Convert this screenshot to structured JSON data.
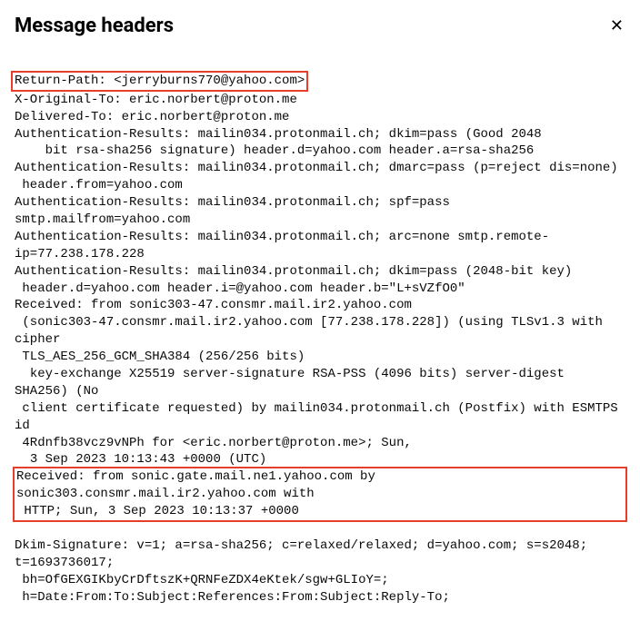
{
  "modal": {
    "title": "Message headers"
  },
  "headers": {
    "return_path": "Return-Path: <jerryburns770@yahoo.com>",
    "x_original_to": "X-Original-To: eric.norbert@proton.me",
    "delivered_to": "Delivered-To: eric.norbert@proton.me",
    "auth1_l1": "Authentication-Results: mailin034.protonmail.ch; dkim=pass (Good 2048",
    "auth1_l2": "    bit rsa-sha256 signature) header.d=yahoo.com header.a=rsa-sha256",
    "auth2_l1": "Authentication-Results: mailin034.protonmail.ch; dmarc=pass (p=reject dis=none)",
    "auth2_l2": " header.from=yahoo.com",
    "auth3_l1": "Authentication-Results: mailin034.protonmail.ch; spf=pass smtp.mailfrom=yahoo.com",
    "auth4_l1": "Authentication-Results: mailin034.protonmail.ch; arc=none smtp.remote-ip=77.238.178.228",
    "auth5_l1": "Authentication-Results: mailin034.protonmail.ch; dkim=pass (2048-bit key)",
    "auth5_l2": " header.d=yahoo.com header.i=@yahoo.com header.b=\"L+sVZfO0\"",
    "recv1_l1": "Received: from sonic303-47.consmr.mail.ir2.yahoo.com",
    "recv1_l2": " (sonic303-47.consmr.mail.ir2.yahoo.com [77.238.178.228]) (using TLSv1.3 with cipher",
    "recv1_l3": " TLS_AES_256_GCM_SHA384 (256/256 bits)",
    "recv1_l4": "  key-exchange X25519 server-signature RSA-PSS (4096 bits) server-digest SHA256) (No",
    "recv1_l5": " client certificate requested) by mailin034.protonmail.ch (Postfix) with ESMTPS id",
    "recv1_l6": " 4Rdnfb38vcz9vNPh for <eric.norbert@proton.me>; Sun,",
    "recv1_l7": "  3 Sep 2023 10:13:43 +0000 (UTC)",
    "recv2_l1": "Received: from sonic.gate.mail.ne1.yahoo.com by",
    "recv2_l2": "sonic303.consmr.mail.ir2.yahoo.com with",
    "recv2_l3": " HTTP; Sun, 3 Sep 2023 10:13:37 +0000",
    "dkim_l1": "Dkim-Signature: v=1; a=rsa-sha256; c=relaxed/relaxed; d=yahoo.com; s=s2048; t=1693736017;",
    "dkim_l2": " bh=OfGEXGIKbyCrDftszK+QRNFeZDX4eKtek/sgw+GLIoY=;",
    "dkim_l3": " h=Date:From:To:Subject:References:From:Subject:Reply-To;"
  }
}
